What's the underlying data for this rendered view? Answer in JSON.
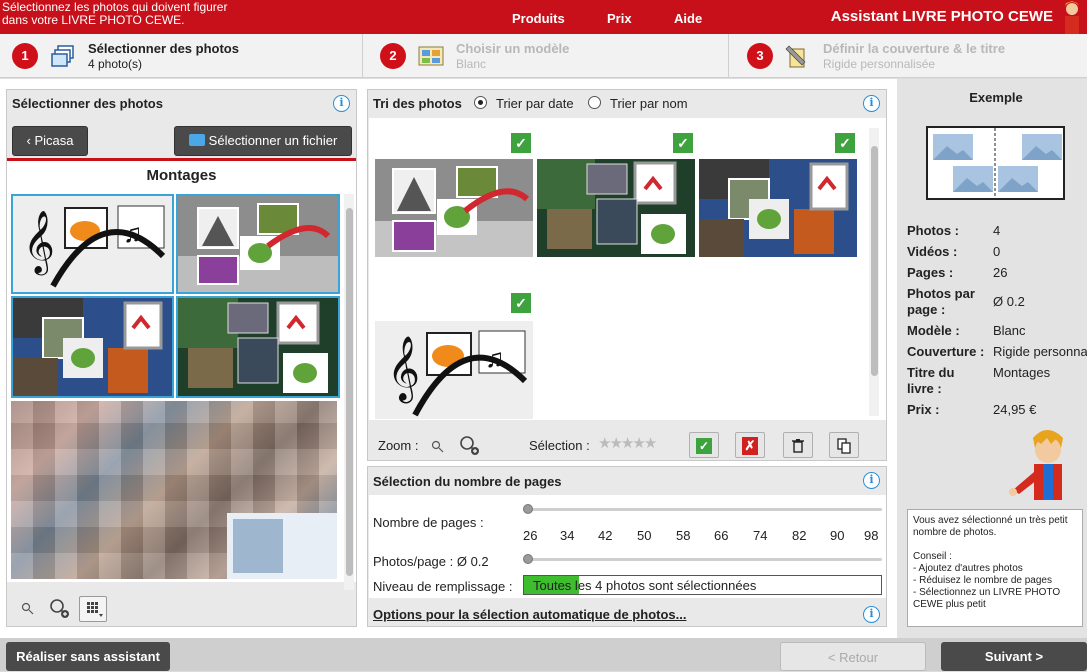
{
  "topbar": {
    "instruction_line1": "Sélectionnez les photos qui doivent figurer",
    "instruction_line2": "dans votre LIVRE PHOTO CEWE.",
    "nav": [
      "Produits",
      "Prix",
      "Aide"
    ],
    "brand": "Assistant LIVRE PHOTO CEWE"
  },
  "steps": [
    {
      "num": "1",
      "title": "Sélectionner des photos",
      "sub": "4 photo(s)"
    },
    {
      "num": "2",
      "title": "Choisir un modèle",
      "sub": "Blanc"
    },
    {
      "num": "3",
      "title": "Définir la couverture & le titre",
      "sub": "Rigide personnalisée"
    }
  ],
  "left": {
    "title": "Sélectionner des photos",
    "picasa": "Picasa",
    "select_file": "Sélectionner un fichier",
    "album": "Montages"
  },
  "middle": {
    "title": "Tri des photos",
    "sort_date": "Trier par date",
    "sort_name": "Trier par nom",
    "zoom": "Zoom :",
    "selection": "Sélection :"
  },
  "pages": {
    "title": "Sélection du nombre de pages",
    "nb_label": "Nombre de pages :",
    "ticks": [
      "26",
      "34",
      "42",
      "50",
      "58",
      "66",
      "74",
      "82",
      "90",
      "98"
    ],
    "per_page_label": "Photos/page :  Ø 0.2",
    "fill_label": "Niveau de remplissage :",
    "fill_highlight": "Toutes",
    "fill_text": " les 4 photos sont sélectionnées",
    "options": "Options pour la sélection automatique de photos..."
  },
  "right": {
    "title": "Exemple",
    "rows": [
      {
        "k": "Photos :",
        "v": "4"
      },
      {
        "k": "Vidéos :",
        "v": "0"
      },
      {
        "k": "Pages :",
        "v": "26"
      },
      {
        "k": "Photos par page :",
        "v": "Ø 0.2"
      },
      {
        "k": "Modèle :",
        "v": "Blanc"
      },
      {
        "k": "Couverture :",
        "v": "Rigide personnalisée"
      },
      {
        "k": "Titre du livre :",
        "v": "Montages"
      },
      {
        "k": "Prix :",
        "v": "24,95 €"
      }
    ],
    "tip_line1": "Vous avez sélectionné un très petit nombre de photos.",
    "tip_conseil": "Conseil :",
    "tip_items": [
      "- Ajoutez d'autres photos",
      "- Réduisez le nombre de pages",
      "- Sélectionnez un LIVRE PHOTO CEWE plus petit"
    ]
  },
  "bottom": {
    "no_assistant": "Réaliser sans assistant",
    "back": "< Retour",
    "next": "Suivant >"
  },
  "colors": {
    "brand_red": "#c8101a",
    "select_blue": "#3aa4d8",
    "check_green": "#3ea33e"
  }
}
